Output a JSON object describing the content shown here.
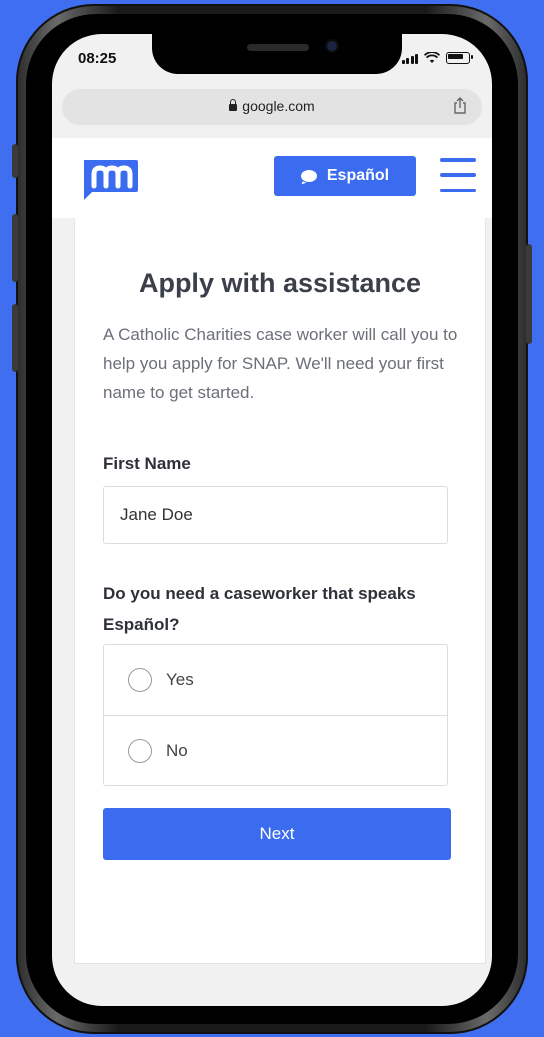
{
  "status_bar": {
    "time": "08:25"
  },
  "browser": {
    "url": "google.com",
    "share_icon": "share-icon",
    "lock_icon": "lock-icon"
  },
  "header": {
    "logo_icon": "m-logo",
    "language_button_label": "Español",
    "language_button_icon": "chat-bubble-icon",
    "menu_icon": "hamburger-menu-icon"
  },
  "form": {
    "title": "Apply with assistance",
    "intro": "A Catholic Charities case worker will call you to help you apply for SNAP. We'll need your first name to get started.",
    "first_name_label": "First Name",
    "first_name_value": "Jane Doe",
    "question": "Do you need a caseworker that speaks Español?",
    "options": [
      {
        "label": "Yes",
        "selected": false
      },
      {
        "label": "No",
        "selected": false
      }
    ],
    "next_label": "Next"
  },
  "colors": {
    "brand_blue": "#3b6cf0",
    "background_blue": "#3f6ff0"
  }
}
